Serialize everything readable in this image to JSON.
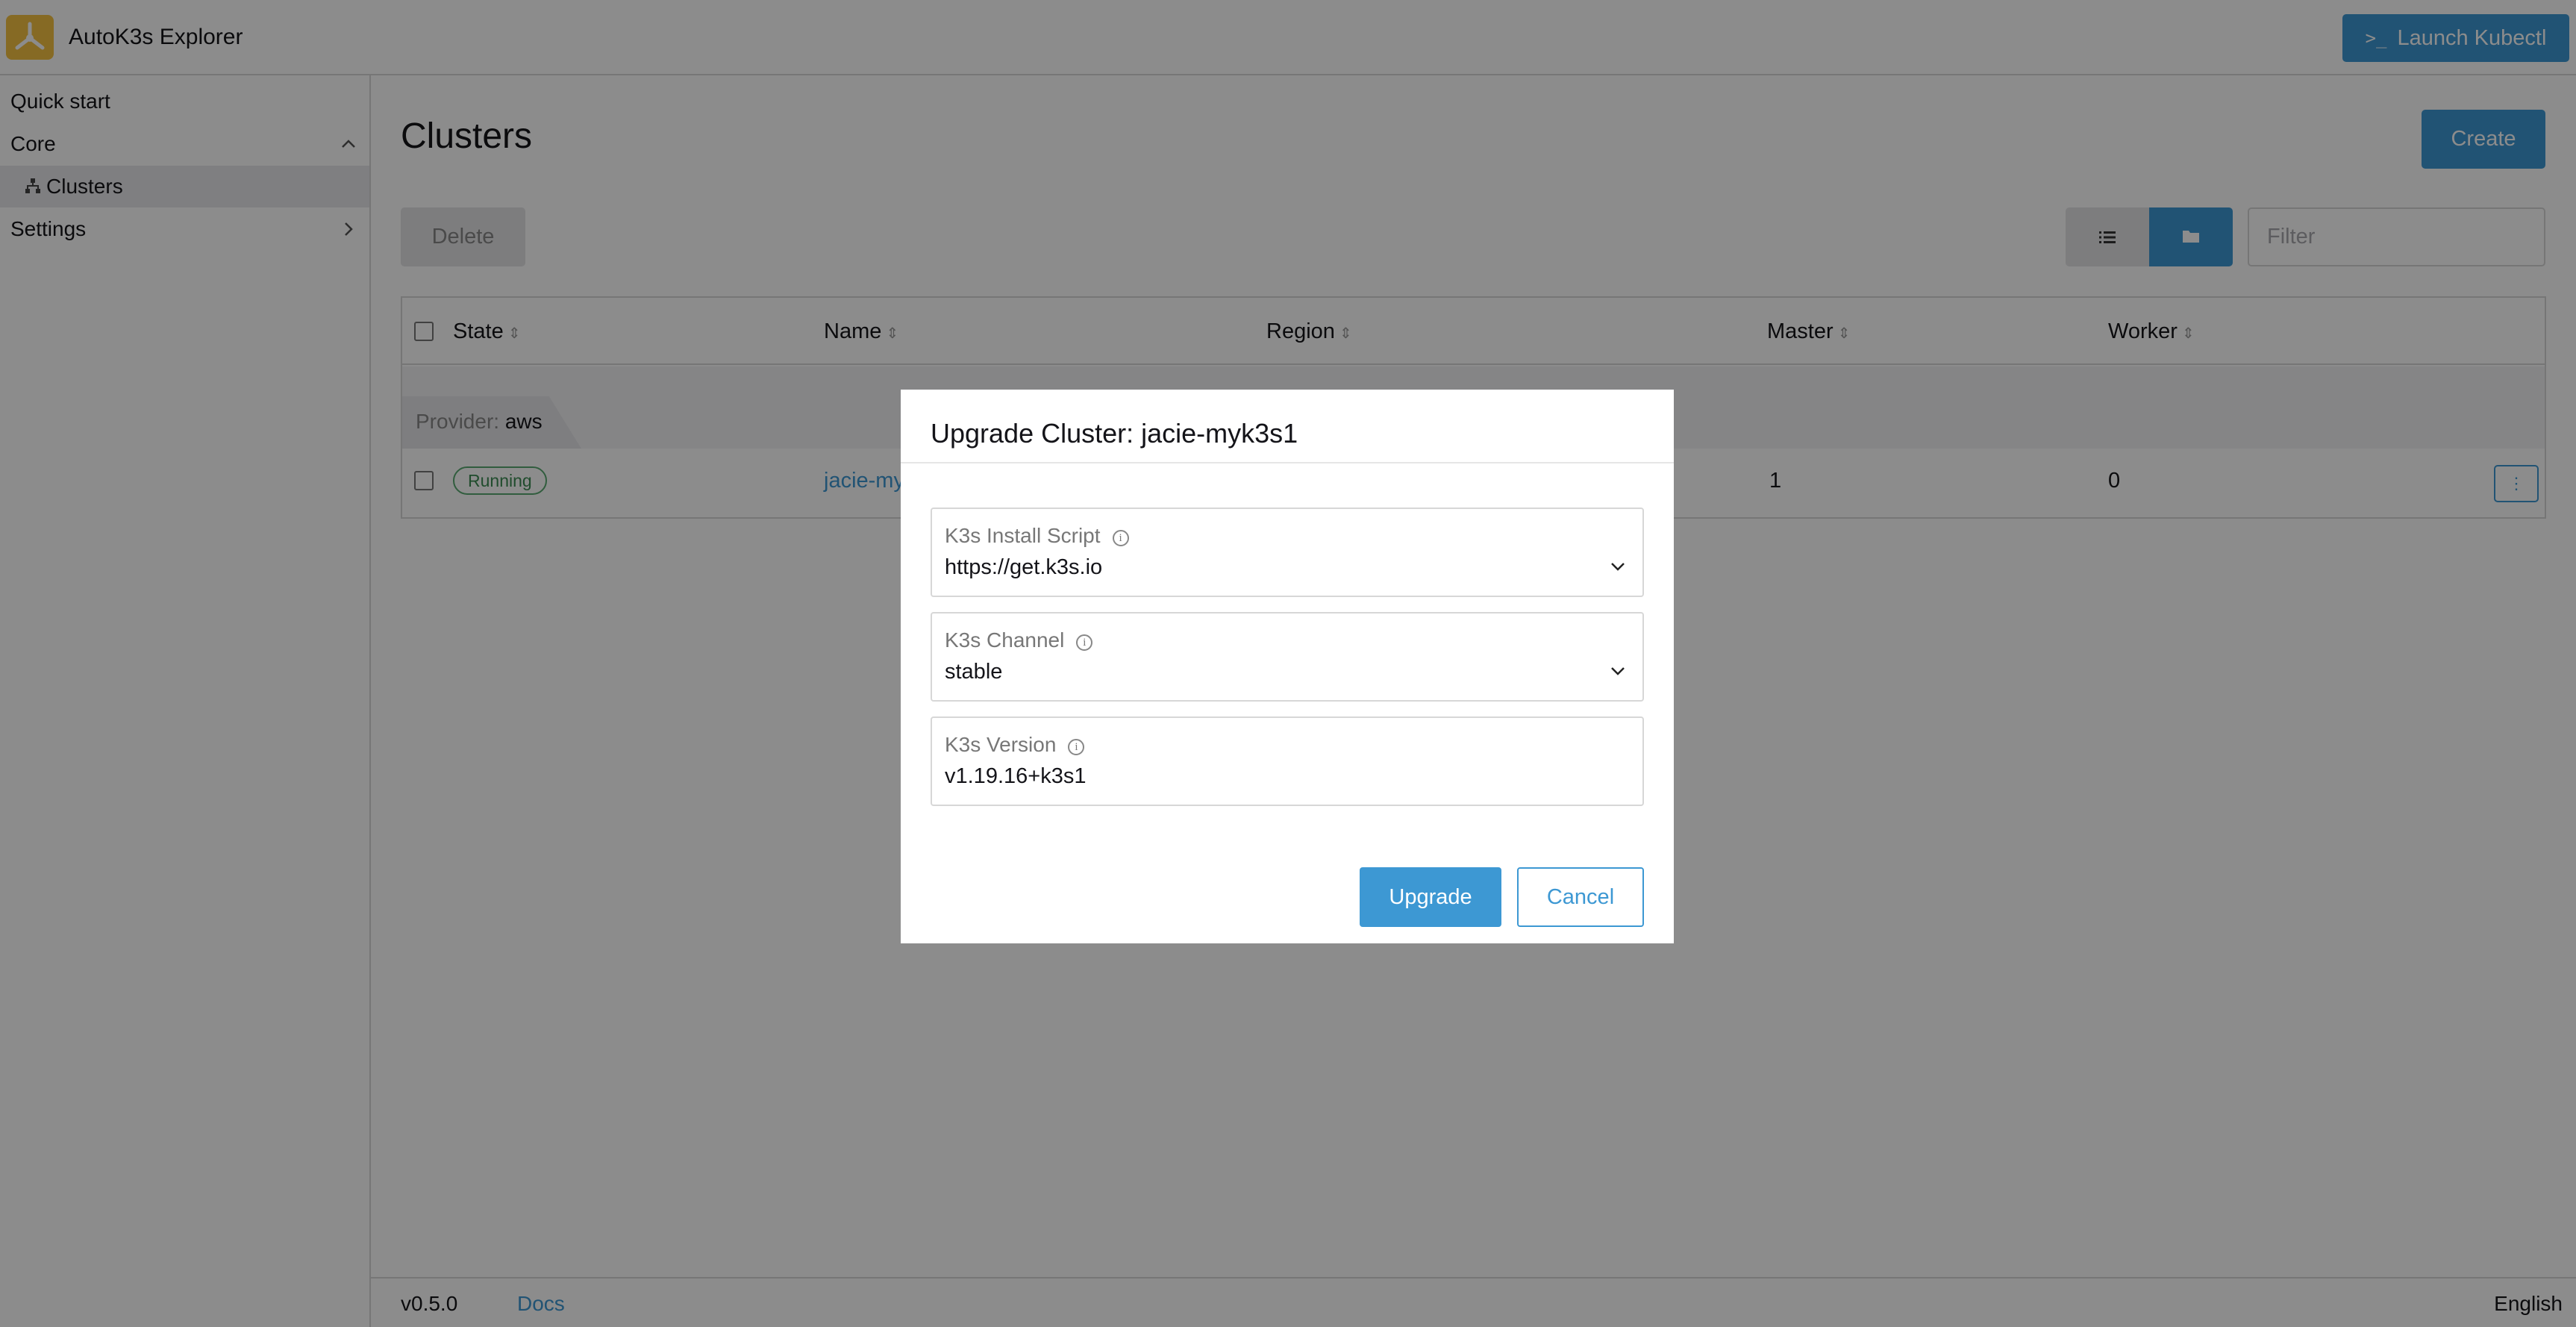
{
  "app": {
    "title": "AutoK3s Explorer",
    "launch_kubectl_label": "Launch Kubectl",
    "launch_kubectl_prompt": ">_"
  },
  "sidebar": {
    "items": [
      {
        "label": "Quick start"
      },
      {
        "label": "Core",
        "expanded": true
      },
      {
        "label": "Clusters",
        "active": true,
        "icon": "cluster-icon"
      },
      {
        "label": "Settings",
        "expanded": false
      }
    ]
  },
  "main": {
    "page_title": "Clusters",
    "create_label": "Create",
    "delete_label": "Delete",
    "filter_placeholder": "Filter",
    "view_modes": [
      "list-icon",
      "folder-icon"
    ],
    "table": {
      "columns": [
        "State",
        "Name",
        "Region",
        "Master",
        "Worker"
      ],
      "group": {
        "prefix": "Provider:",
        "value": "aws"
      },
      "rows": [
        {
          "state": "Running",
          "name": "jacie-my",
          "region": "",
          "master": "1",
          "worker": "0"
        }
      ]
    }
  },
  "footer": {
    "version": "v0.5.0",
    "docs_label": "Docs",
    "language": "English"
  },
  "modal": {
    "title": "Upgrade Cluster: jacie-myk3s1",
    "fields": [
      {
        "label": "K3s Install Script",
        "value": "https://get.k3s.io",
        "type": "select"
      },
      {
        "label": "K3s Channel",
        "value": "stable",
        "type": "select"
      },
      {
        "label": "K3s Version",
        "value": "v1.19.16+k3s1",
        "type": "text"
      }
    ],
    "upgrade_label": "Upgrade",
    "cancel_label": "Cancel"
  },
  "colors": {
    "accent": "#3d98d3",
    "logo": "#f4c242",
    "running": "#5aa971",
    "overlay": "rgba(0,0,0,0.45)"
  }
}
